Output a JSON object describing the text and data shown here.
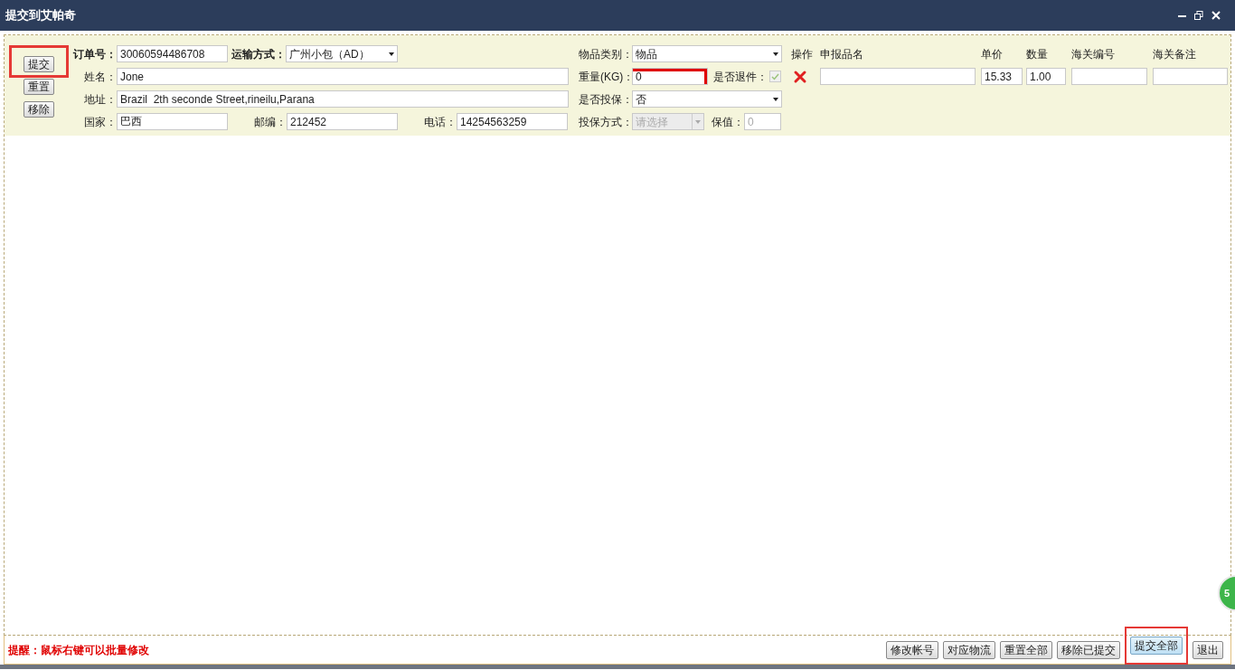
{
  "window": {
    "title": "提交到艾帕奇"
  },
  "row_buttons": [
    {
      "label": "提交",
      "highlighted": true
    },
    {
      "label": "重置",
      "highlighted": false
    },
    {
      "label": "移除",
      "highlighted": false
    }
  ],
  "order": {
    "order_no": {
      "label": "订单号：",
      "value": "30060594486708"
    },
    "shipping": {
      "label": "运输方式：",
      "value": "广州小包（AD）"
    },
    "name": {
      "label": "姓名：",
      "value": "Jone"
    },
    "address": {
      "label": "地址：",
      "value": "Brazil  2th seconde Street,rineilu,Parana"
    },
    "country": {
      "label": "国家：",
      "value": "巴西"
    },
    "postcode": {
      "label": "邮编：",
      "value": "212452"
    },
    "phone": {
      "label": "电话：",
      "value": "14254563259"
    },
    "category": {
      "label": "物品类别：",
      "value": "物品"
    },
    "weight": {
      "label": "重量(KG)：",
      "value": "0",
      "invalid": true
    },
    "return": {
      "label": "是否退件：",
      "checked": true,
      "disabled": true
    },
    "insured": {
      "label": "是否投保：",
      "value": "否"
    },
    "insure_method": {
      "label": "投保方式：",
      "placeholder": "请选择",
      "disabled": true
    },
    "insured_value": {
      "label": "保值：",
      "value": "0",
      "disabled": true
    }
  },
  "declaration": {
    "columns": [
      "操作",
      "申报品名",
      "单价",
      "数量",
      "海关编号",
      "海关备注"
    ],
    "rows": [
      {
        "name": "",
        "price": "15.33",
        "quantity": "1.00",
        "hs_code": "",
        "remark": ""
      }
    ]
  },
  "footer": {
    "hint": "提醒：鼠标右键可以批量修改",
    "buttons": [
      {
        "label": "修改帐号",
        "highlighted": false
      },
      {
        "label": "对应物流",
        "highlighted": false
      },
      {
        "label": "重置全部",
        "highlighted": false
      },
      {
        "label": "移除已提交",
        "highlighted": false
      },
      {
        "label": "提交全部",
        "highlighted": true
      },
      {
        "label": "退出",
        "highlighted": false
      }
    ]
  },
  "badge": "5"
}
